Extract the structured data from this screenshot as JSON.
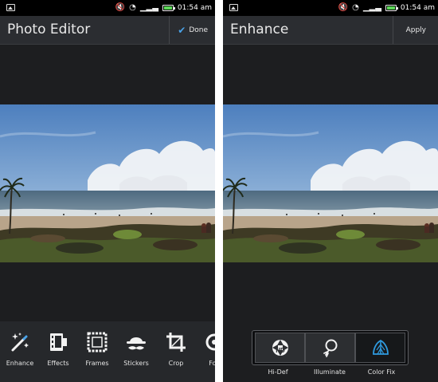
{
  "status_bar": {
    "time": "01:54",
    "ampm": "am"
  },
  "left_screen": {
    "title": "Photo Editor",
    "done_label": "Done",
    "tools": [
      {
        "label": "Enhance",
        "icon": "magic-wand-icon"
      },
      {
        "label": "Effects",
        "icon": "film-strip-icon"
      },
      {
        "label": "Frames",
        "icon": "frame-icon"
      },
      {
        "label": "Stickers",
        "icon": "hat-mustache-icon"
      },
      {
        "label": "Crop",
        "icon": "crop-icon"
      },
      {
        "label": "Foc",
        "icon": "focus-icon"
      }
    ]
  },
  "right_screen": {
    "title": "Enhance",
    "apply_label": "Apply",
    "options": [
      {
        "label": "Hi-Def",
        "icon": "hd-aperture-icon",
        "selected": false
      },
      {
        "label": "Illuminate",
        "icon": "lightbulb-icon",
        "selected": false
      },
      {
        "label": "Color Fix",
        "icon": "color-fix-icon",
        "selected": true
      }
    ]
  },
  "colors": {
    "accent": "#4aa3e8",
    "battery": "#5ed85a",
    "background": "#1d1e20",
    "selected_icon": "#2f9be0"
  }
}
